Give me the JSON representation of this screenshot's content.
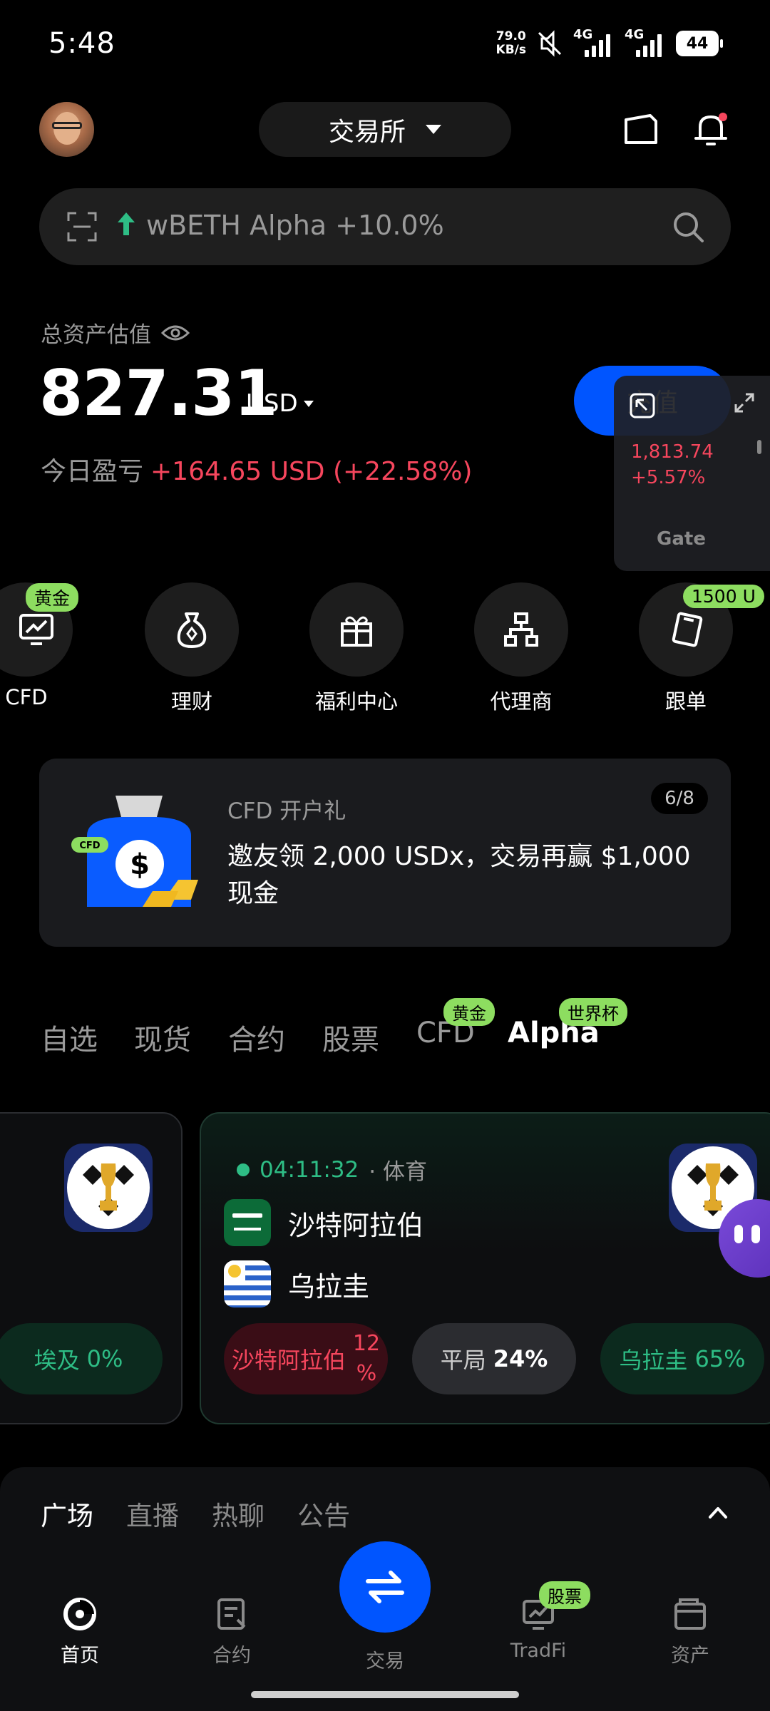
{
  "status_bar": {
    "time": "5:48",
    "net_speed_value": "79.0",
    "net_speed_unit": "KB/s",
    "signal_1_label": "4G",
    "signal_2_label": "4G",
    "battery": "44"
  },
  "header": {
    "exchange_label": "交易所"
  },
  "search": {
    "placeholder": "wBETH Alpha +10.0%"
  },
  "balance": {
    "label": "总资产估值",
    "value": "827.31",
    "currency": "USD",
    "pnl_label": "今日盈亏",
    "pnl_value": "+164.65 USD (+22.58%)",
    "deposit_label": "充值"
  },
  "float_widget": {
    "price": "1,813.74",
    "change": "+5.57%",
    "brand": "Gate"
  },
  "quick_actions": [
    {
      "label": "CFD",
      "badge": "黄金",
      "icon": "chart-monitor-icon"
    },
    {
      "label": "理财",
      "badge": "",
      "icon": "money-bag-icon"
    },
    {
      "label": "福利中心",
      "badge": "",
      "icon": "gift-icon"
    },
    {
      "label": "代理商",
      "badge": "",
      "icon": "org-chart-icon"
    },
    {
      "label": "跟单",
      "badge": "1500 U",
      "icon": "copy-trade-icon"
    }
  ],
  "promo": {
    "title": "CFD 开户礼",
    "description": "邀友领 2,000 USDx，交易再赢 $1,000 现金",
    "page": "6/8",
    "art_tag": "CFD"
  },
  "market_tabs": [
    {
      "label": "自选",
      "badge": ""
    },
    {
      "label": "现货",
      "badge": ""
    },
    {
      "label": "合约",
      "badge": ""
    },
    {
      "label": "股票",
      "badge": ""
    },
    {
      "label": "CFD",
      "badge": "黄金"
    },
    {
      "label": "Alpha",
      "badge": "世界杯"
    }
  ],
  "event_left": {
    "option_label": "埃及",
    "option_pct": "0%"
  },
  "event_main": {
    "countdown": "04:11:32",
    "separator": "·",
    "category": "体育",
    "team_1": "沙特阿拉伯",
    "team_2": "乌拉圭",
    "options": [
      {
        "label": "沙特阿拉伯",
        "pct": "12",
        "pct_unit": "%"
      },
      {
        "label": "平局",
        "pct": "24%"
      },
      {
        "label": "乌拉圭",
        "pct": "65%"
      }
    ]
  },
  "sheet_tabs": [
    "广场",
    "直播",
    "热聊",
    "公告"
  ],
  "bottom_nav": [
    {
      "label": "首页",
      "icon": "home-icon",
      "badge": ""
    },
    {
      "label": "合约",
      "icon": "futures-icon",
      "badge": ""
    },
    {
      "label": "交易",
      "icon": "swap-icon",
      "badge": ""
    },
    {
      "label": "TradFi",
      "icon": "tradfi-icon",
      "badge": "股票"
    },
    {
      "label": "资产",
      "icon": "wallet-icon",
      "badge": ""
    }
  ],
  "colors": {
    "accent": "#0055ff",
    "up_red": "#f6465d",
    "green": "#2ebd85",
    "badge_green": "#8ddd60"
  }
}
